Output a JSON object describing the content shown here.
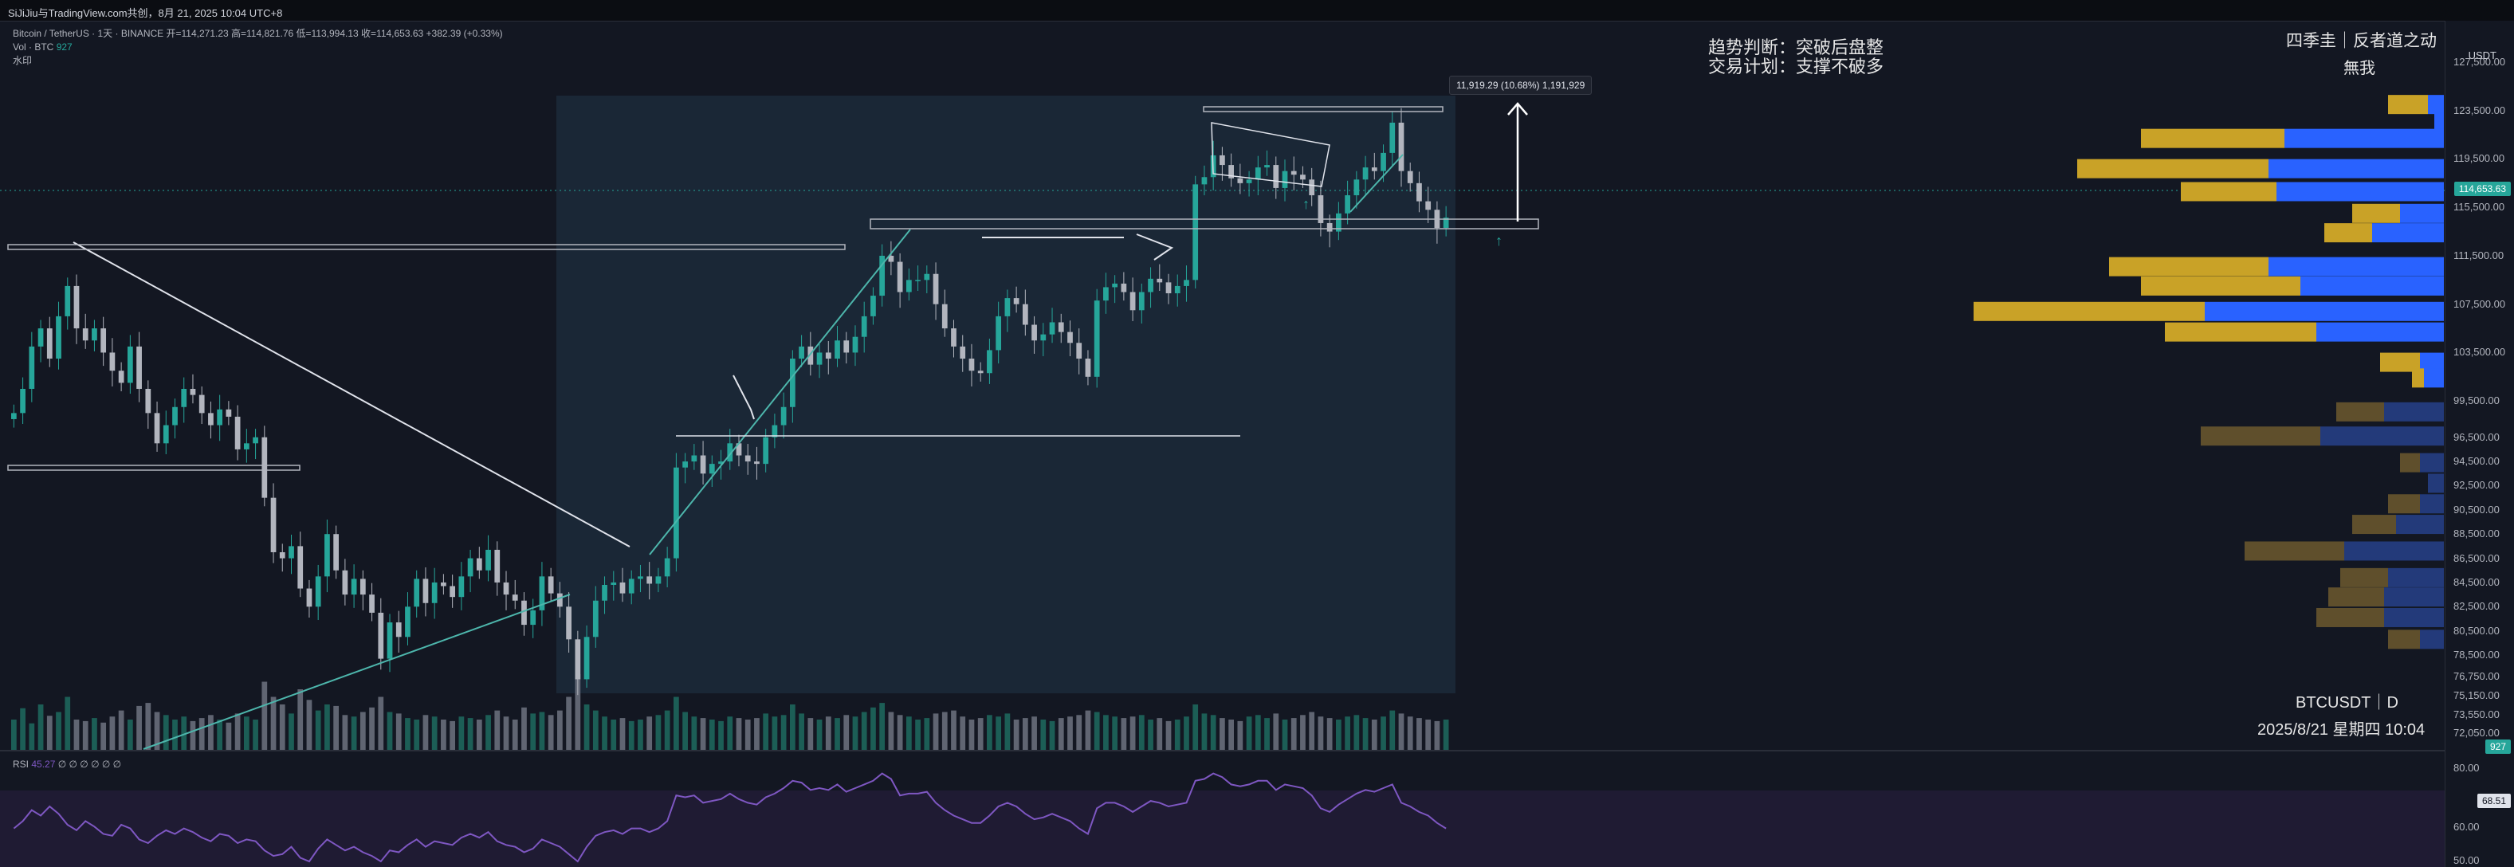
{
  "header": {
    "topline": "SiJiJiu与TradingView.com共创，8月 21, 2025 10:04 UTC+8"
  },
  "legend": {
    "line1": "Bitcoin / TetherUS · 1天 · BINANCE  开=114,271.23  高=114,821.76  低=113,994.13  收=114,653.63  +382.39 (+0.33%)",
    "line2_label": "Vol · BTC",
    "line2_value": "927",
    "line3": "水印"
  },
  "annotations": {
    "trend_title": "趋势判断：突破后盘整",
    "plan_title": "交易计划：支撑不破多",
    "brand_1": "四季圭｜反者道之动",
    "brand_2": "無我",
    "symbol": "BTCUSDT｜D",
    "datetime": "2025/8/21 星期四 10:04",
    "measure": "11,919.29 (10.68%) 1,191,929"
  },
  "axis": {
    "unit": "USDT",
    "last_price": "114,653.63",
    "volume_tag": "927",
    "rsi_tag": "68.51"
  },
  "rsi": {
    "label": "RSI",
    "value": "45.27",
    "rest": "∅ ∅ ∅ ∅ ∅ ∅",
    "ticks": [
      "80.00",
      "60.00",
      "50.00"
    ]
  },
  "colors": {
    "up": "#26a69a",
    "down": "#b2b5be",
    "rsi": "#7e57c2",
    "vp_gold": "#c9a227",
    "vp_blue": "#2962ff",
    "box": "#1c2a3a"
  },
  "chart_data": {
    "type": "candlestick",
    "symbol": "BTCUSDT",
    "interval": "1D",
    "price_ticks": [
      127500,
      123500,
      119500,
      115500,
      111500,
      107500,
      103500,
      99500,
      96500,
      94500,
      92500,
      90500,
      88500,
      86500,
      84500,
      82500,
      80500,
      78500,
      76750,
      75150,
      73550,
      72050
    ],
    "ylim": [
      71500,
      128500
    ],
    "closes": [
      98500,
      100500,
      104000,
      105500,
      103000,
      106500,
      109000,
      105500,
      104500,
      105500,
      103500,
      102000,
      101000,
      104000,
      100500,
      98500,
      96000,
      97500,
      99000,
      100500,
      100000,
      98500,
      97500,
      98800,
      98200,
      95500,
      96000,
      96500,
      91500,
      87000,
      86500,
      87500,
      84000,
      82500,
      85000,
      88500,
      85500,
      83500,
      84800,
      83500,
      82000,
      78200,
      81200,
      80000,
      82500,
      84800,
      82800,
      84500,
      84200,
      83300,
      85000,
      86500,
      85500,
      87200,
      84500,
      83500,
      83000,
      81000,
      82200,
      85000,
      83600,
      82500,
      79800,
      76500,
      80000,
      83000,
      84300,
      84500,
      83600,
      84800,
      85000,
      84400,
      85000,
      86500,
      94000,
      94500,
      95000,
      93500,
      94300,
      94500,
      96000,
      95000,
      94500,
      94300,
      96500,
      97500,
      99000,
      103000,
      104000,
      102500,
      103500,
      103000,
      104500,
      103500,
      104800,
      106500,
      108200,
      111500,
      111000,
      108500,
      109500,
      109500,
      110000,
      107500,
      105500,
      104000,
      103000,
      102000,
      101800,
      103700,
      106500,
      108000,
      107500,
      105800,
      104500,
      105000,
      106000,
      105200,
      104300,
      103000,
      101500,
      107800,
      108900,
      109200,
      108500,
      107000,
      108500,
      109600,
      109300,
      108400,
      109000,
      109500,
      117400,
      118000,
      119800,
      119000,
      117900,
      117500,
      117800,
      118800,
      119000,
      117100,
      118500,
      118200,
      117800,
      116500,
      114200,
      113500,
      115000,
      116500,
      117800,
      118800,
      118500,
      120000,
      122500,
      118500,
      117500,
      116000,
      115300,
      113800,
      114653.63
    ],
    "volume_note": "relative volume per bar",
    "volume": [
      40,
      55,
      35,
      60,
      45,
      50,
      70,
      40,
      38,
      42,
      36,
      44,
      52,
      40,
      58,
      62,
      50,
      46,
      40,
      44,
      38,
      42,
      46,
      40,
      36,
      48,
      44,
      40,
      90,
      70,
      60,
      48,
      80,
      66,
      52,
      60,
      58,
      46,
      44,
      50,
      56,
      70,
      50,
      48,
      42,
      40,
      46,
      44,
      40,
      38,
      44,
      42,
      40,
      46,
      52,
      44,
      40,
      56,
      48,
      50,
      46,
      52,
      70,
      100,
      60,
      52,
      44,
      40,
      42,
      38,
      40,
      44,
      46,
      52,
      70,
      50,
      44,
      42,
      40,
      38,
      44,
      42,
      40,
      42,
      48,
      44,
      46,
      60,
      48,
      42,
      40,
      44,
      42,
      46,
      44,
      50,
      56,
      62,
      50,
      46,
      44,
      40,
      42,
      48,
      50,
      52,
      44,
      40,
      42,
      46,
      44,
      48,
      40,
      42,
      44,
      40,
      38,
      42,
      44,
      46,
      52,
      50,
      46,
      44,
      42,
      44,
      46,
      40,
      42,
      38,
      40,
      44,
      60,
      48,
      46,
      42,
      40,
      38,
      44,
      46,
      42,
      48,
      40,
      42,
      46,
      50,
      44,
      42,
      40,
      44,
      46,
      42,
      40,
      44,
      52,
      48,
      44,
      42,
      40,
      38
    ],
    "rsi_values": [
      48,
      52,
      58,
      55,
      60,
      56,
      50,
      47,
      52,
      49,
      45,
      44,
      50,
      48,
      42,
      40,
      44,
      47,
      45,
      48,
      46,
      43,
      41,
      45,
      44,
      40,
      42,
      41,
      36,
      33,
      34,
      38,
      32,
      30,
      37,
      42,
      39,
      36,
      38,
      35,
      33,
      30,
      36,
      35,
      39,
      42,
      38,
      41,
      40,
      39,
      43,
      45,
      43,
      46,
      41,
      39,
      38,
      35,
      37,
      42,
      40,
      38,
      34,
      30,
      38,
      44,
      46,
      47,
      45,
      48,
      48,
      46,
      48,
      52,
      66,
      65,
      66,
      62,
      63,
      64,
      67,
      64,
      62,
      61,
      65,
      67,
      70,
      74,
      73,
      69,
      70,
      69,
      72,
      68,
      70,
      72,
      74,
      78,
      75,
      66,
      67,
      67,
      68,
      62,
      58,
      55,
      53,
      51,
      51,
      55,
      60,
      62,
      60,
      56,
      53,
      54,
      56,
      54,
      52,
      48,
      45,
      59,
      62,
      62,
      60,
      57,
      60,
      63,
      62,
      60,
      61,
      62,
      74,
      75,
      78,
      76,
      72,
      71,
      72,
      74,
      74,
      69,
      72,
      71,
      70,
      66,
      59,
      57,
      61,
      64,
      67,
      69,
      68,
      70,
      72,
      62,
      60,
      57,
      55,
      51,
      48
    ]
  },
  "volume_profile_note": "right side horizontal volume profile bars (gold = sell, blue = buy)",
  "volume_profile": [
    {
      "price": 124000,
      "gold": 50,
      "blue": 20
    },
    {
      "price": 122500,
      "gold": 0,
      "blue": 12
    },
    {
      "price": 121200,
      "gold": 180,
      "blue": 200
    },
    {
      "price": 118700,
      "gold": 240,
      "blue": 220
    },
    {
      "price": 116800,
      "gold": 120,
      "blue": 210
    },
    {
      "price": 115000,
      "gold": 60,
      "blue": 55
    },
    {
      "price": 113400,
      "gold": 60,
      "blue": 90
    },
    {
      "price": 110600,
      "gold": 200,
      "blue": 220
    },
    {
      "price": 109000,
      "gold": 200,
      "blue": 180
    },
    {
      "price": 106900,
      "gold": 290,
      "blue": 300
    },
    {
      "price": 105200,
      "gold": 190,
      "blue": 160
    },
    {
      "price": 102700,
      "gold": 50,
      "blue": 30
    },
    {
      "price": 101400,
      "gold": 15,
      "blue": 25
    },
    {
      "price": 98600,
      "gold": 60,
      "blue": 75
    },
    {
      "price": 96600,
      "gold": 150,
      "blue": 155
    },
    {
      "price": 94400,
      "gold": 25,
      "blue": 30
    },
    {
      "price": 92700,
      "gold": 0,
      "blue": 20
    },
    {
      "price": 91000,
      "gold": 40,
      "blue": 30
    },
    {
      "price": 89300,
      "gold": 55,
      "blue": 60
    },
    {
      "price": 87100,
      "gold": 125,
      "blue": 125
    },
    {
      "price": 84900,
      "gold": 60,
      "blue": 70
    },
    {
      "price": 83300,
      "gold": 70,
      "blue": 75
    },
    {
      "price": 81600,
      "gold": 85,
      "blue": 75
    },
    {
      "price": 79800,
      "gold": 40,
      "blue": 30
    }
  ]
}
